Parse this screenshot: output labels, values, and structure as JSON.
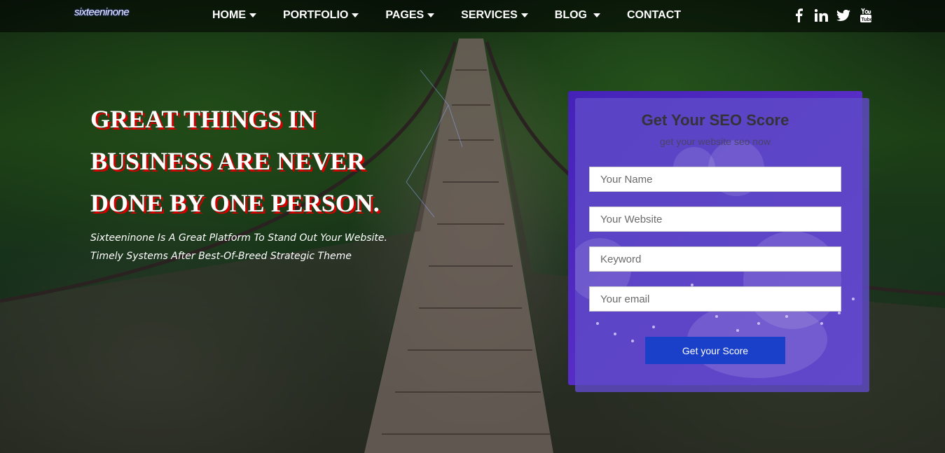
{
  "header": {
    "logo_text": "sixteeninone",
    "nav": [
      {
        "label": "HOME",
        "has_dropdown": true
      },
      {
        "label": "PORTFOLIO",
        "has_dropdown": true
      },
      {
        "label": "PAGES",
        "has_dropdown": true
      },
      {
        "label": "SERVICES",
        "has_dropdown": true
      },
      {
        "label": "BLOG",
        "has_dropdown": true
      },
      {
        "label": "CONTACT",
        "has_dropdown": false
      }
    ],
    "socials": [
      "facebook-icon",
      "linkedin-icon",
      "twitter-icon",
      "youtube-icon"
    ]
  },
  "hero": {
    "headline_lines": [
      "GREAT THINGS IN",
      "BUSINESS ARE NEVER",
      "DONE BY ONE PERSON."
    ],
    "tagline": "Sixteeninone Is A Great Platform To Stand Out Your Website. Timely Systems After Best-Of-Breed Strategic Theme"
  },
  "seo_form": {
    "title": "Get Your SEO Score",
    "subtitle": "get your website seo now",
    "fields": {
      "name_placeholder": "Your Name",
      "website_placeholder": "Your Website",
      "keyword_placeholder": "Keyword",
      "email_placeholder": "Your email"
    },
    "submit_label": "Get your Score"
  },
  "colors": {
    "headline_shadow": "#d40000",
    "card_bg": "#5f4bc8",
    "button_bg": "#1a3fc8"
  }
}
